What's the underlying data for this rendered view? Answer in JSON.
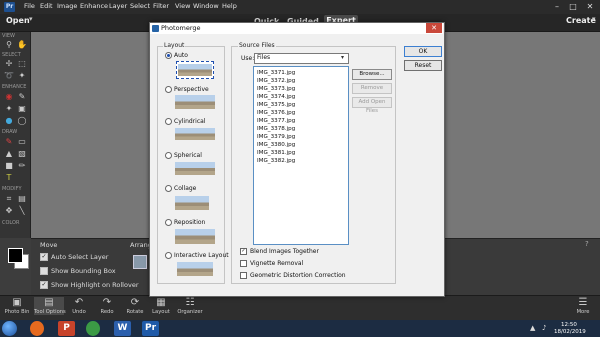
{
  "menubar": {
    "logo": "Pr",
    "items": [
      "File",
      "Edit",
      "Image",
      "Enhance",
      "Layer",
      "Select",
      "Filter",
      "View",
      "Window",
      "Help"
    ]
  },
  "modebar": {
    "open_label": "Open",
    "tabs": [
      "Quick",
      "Guided",
      "Expert"
    ],
    "create_label": "Create"
  },
  "toolbox": {
    "sections": [
      "VIEW",
      "SELECT",
      "ENHANCE",
      "DRAW",
      "MODIFY",
      "COLOR"
    ]
  },
  "tool_options": {
    "title": "Move",
    "arrange_label": "Arrange",
    "options": [
      {
        "label": "Auto Select Layer",
        "checked": true
      },
      {
        "label": "Show Bounding Box",
        "checked": false
      },
      {
        "label": "Show Highlight on Rollover",
        "checked": true
      }
    ],
    "help": "?"
  },
  "panelbar": {
    "left": [
      {
        "label": "Photo Bin",
        "icon": "photo-bin-icon"
      },
      {
        "label": "Tool Options",
        "icon": "tool-options-icon"
      },
      {
        "label": "Undo",
        "icon": "undo-icon"
      },
      {
        "label": "Redo",
        "icon": "redo-icon"
      },
      {
        "label": "Rotate",
        "icon": "rotate-icon"
      },
      {
        "label": "Layout",
        "icon": "layout-icon"
      },
      {
        "label": "Organizer",
        "icon": "organizer-icon"
      }
    ],
    "right": {
      "label": "More",
      "icon": "more-icon"
    }
  },
  "dialog": {
    "title": "Photomerge",
    "layout_legend": "Layout",
    "layout_options": [
      {
        "label": "Auto",
        "selected": true
      },
      {
        "label": "Perspective",
        "selected": false
      },
      {
        "label": "Cylindrical",
        "selected": false
      },
      {
        "label": "Spherical",
        "selected": false
      },
      {
        "label": "Collage",
        "selected": false
      },
      {
        "label": "Reposition",
        "selected": false
      },
      {
        "label": "Interactive Layout",
        "selected": false
      }
    ],
    "source_legend": "Source Files",
    "use_label": "Use:",
    "use_value": "Files",
    "files": [
      "IMG_3371.jpg",
      "IMG_3372.jpg",
      "IMG_3373.jpg",
      "IMG_3374.jpg",
      "IMG_3375.jpg",
      "IMG_3376.jpg",
      "IMG_3377.jpg",
      "IMG_3378.jpg",
      "IMG_3379.jpg",
      "IMG_3380.jpg",
      "IMG_3381.jpg",
      "IMG_3382.jpg"
    ],
    "buttons": {
      "browse": "Browse...",
      "remove": "Remove",
      "add_open_files": "Add Open Files",
      "ok": "OK",
      "reset": "Reset"
    },
    "checkboxes": [
      {
        "label": "Blend Images Together",
        "checked": true
      },
      {
        "label": "Vignette Removal",
        "checked": false
      },
      {
        "label": "Geometric Distortion Correction",
        "checked": false
      }
    ]
  },
  "taskbar": {
    "time": "12:50",
    "date": "18/02/2019",
    "apps": [
      {
        "name": "firefox-icon",
        "color": "#e66a1f"
      },
      {
        "name": "powerpoint-icon",
        "color": "#c7432b"
      },
      {
        "name": "chrome-icon",
        "color": "#3b9a45"
      },
      {
        "name": "word-icon",
        "color": "#2b5fad"
      },
      {
        "name": "photoshop-elements-icon",
        "color": "#1f5aa8"
      }
    ]
  },
  "colors": {
    "accent": "#1e4fb0",
    "canvas": "#777777",
    "list_border": "#5a8fc4"
  }
}
